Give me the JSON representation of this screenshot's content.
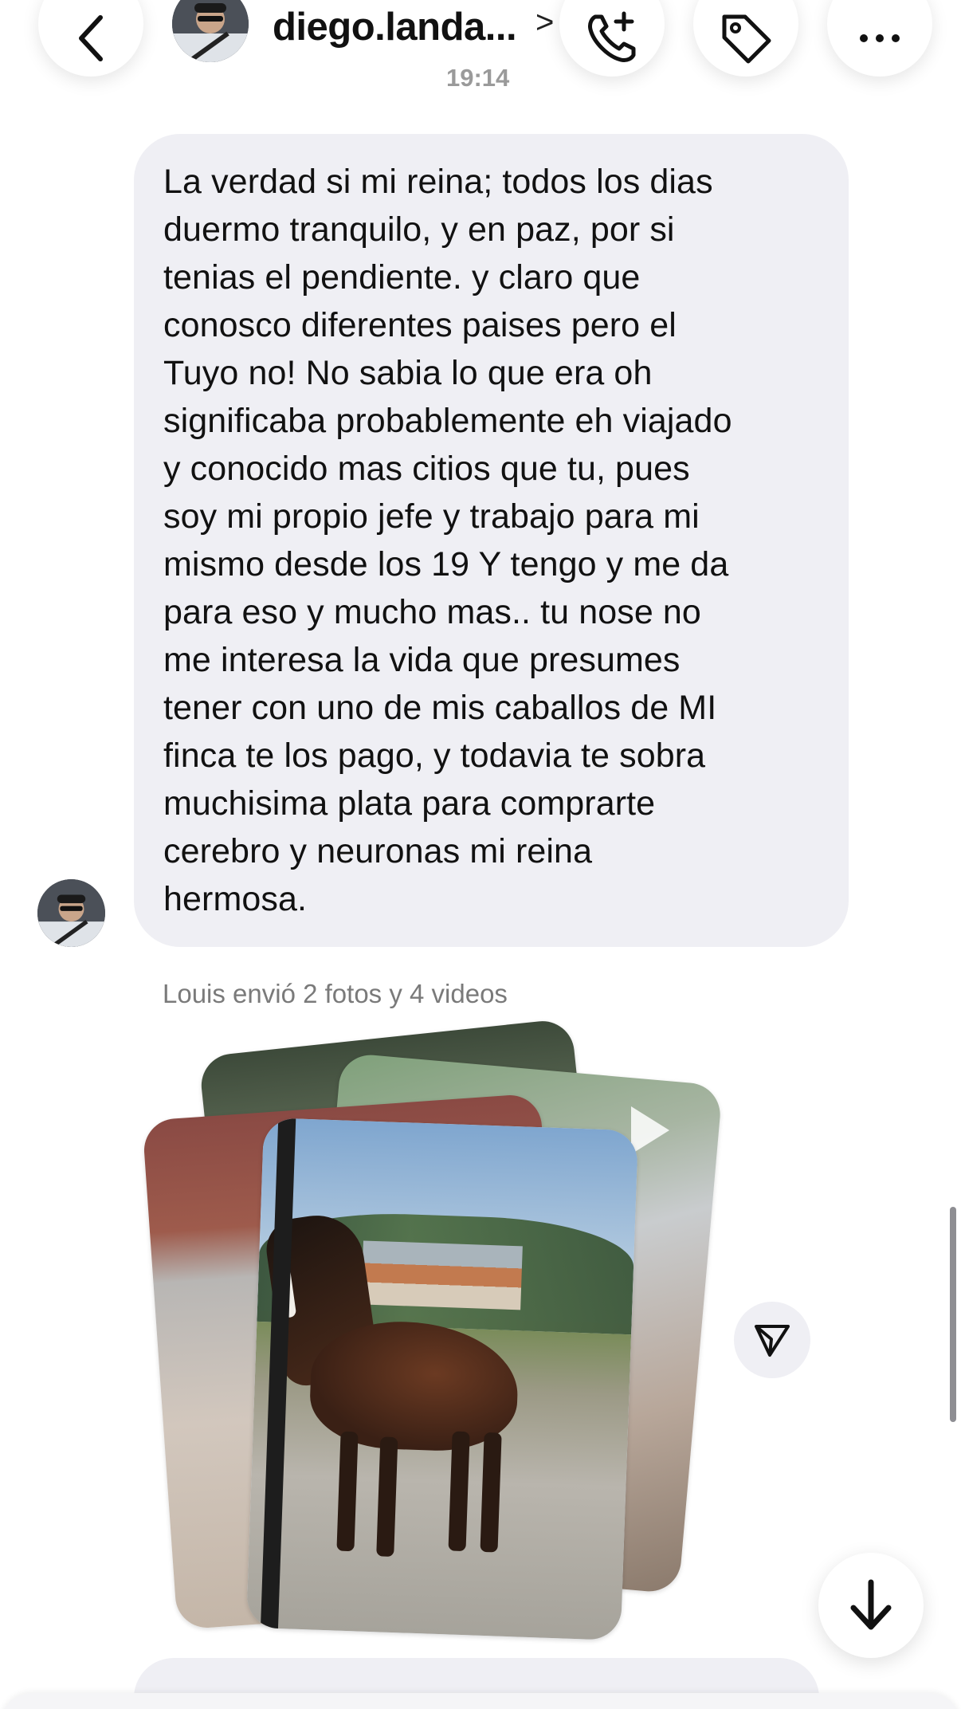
{
  "header": {
    "contact_name": "diego.landa...",
    "chevron": ">",
    "time": "19:14",
    "icons": {
      "back": "chevron-left-icon",
      "call": "phone-plus-icon",
      "tag": "tag-icon",
      "more": "ellipsis-icon"
    }
  },
  "message": {
    "text": "La verdad si mi reina; todos los dias\nduermo tranquilo, y en paz, por si\ntenias el pendiente. y claro que\nconosco diferentes paises pero el\nTuyo no! No sabia lo que era oh\nsignificaba probablemente eh viajado\ny conocido mas citios que tu, pues\nsoy mi propio jefe y trabajo para mi\nmismo desde los 19 Y tengo y me da\npara eso y mucho mas.. tu nose no\nme interesa la vida que presumes\ntener con uno de mis caballos de MI\nfinca te los pago, y todavia te sobra\nmuchisima plata para comprarte\ncerebro y neuronas mi reina\nhermosa."
  },
  "system_note": "Louis envió 2 fotos y 4 videos",
  "media": {
    "photo_count": 2,
    "video_count": 4
  },
  "colors": {
    "bubble": "#efeff4",
    "accent_gradient": "#a74ff0",
    "text": "#111111",
    "muted": "#7a7a7a"
  }
}
